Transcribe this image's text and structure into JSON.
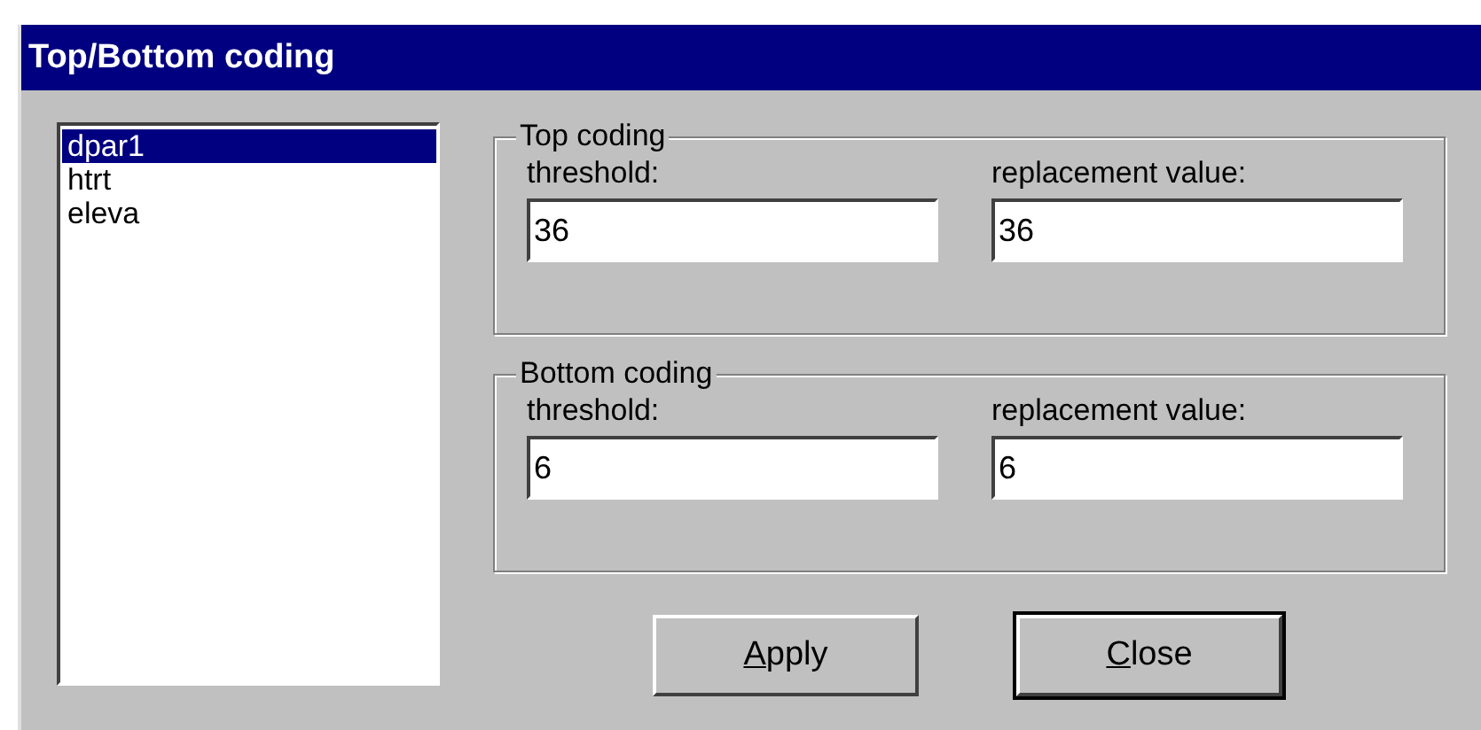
{
  "window": {
    "title": "Top/Bottom coding"
  },
  "list": {
    "items": [
      {
        "label": "dpar1",
        "selected": true
      },
      {
        "label": "htrt",
        "selected": false
      },
      {
        "label": "eleva",
        "selected": false
      }
    ]
  },
  "groups": [
    {
      "title": "Top coding",
      "fields": [
        {
          "label": "threshold:",
          "value": "36"
        },
        {
          "label": "replacement value:",
          "value": "36"
        }
      ]
    },
    {
      "title": "Bottom coding",
      "fields": [
        {
          "label": "threshold:",
          "value": "6"
        },
        {
          "label": "replacement value:",
          "value": "6"
        }
      ]
    }
  ],
  "buttons": [
    {
      "access_key": "A",
      "label_rest": "pply",
      "default": false
    },
    {
      "access_key": "C",
      "label_rest": "lose",
      "default": true
    }
  ]
}
